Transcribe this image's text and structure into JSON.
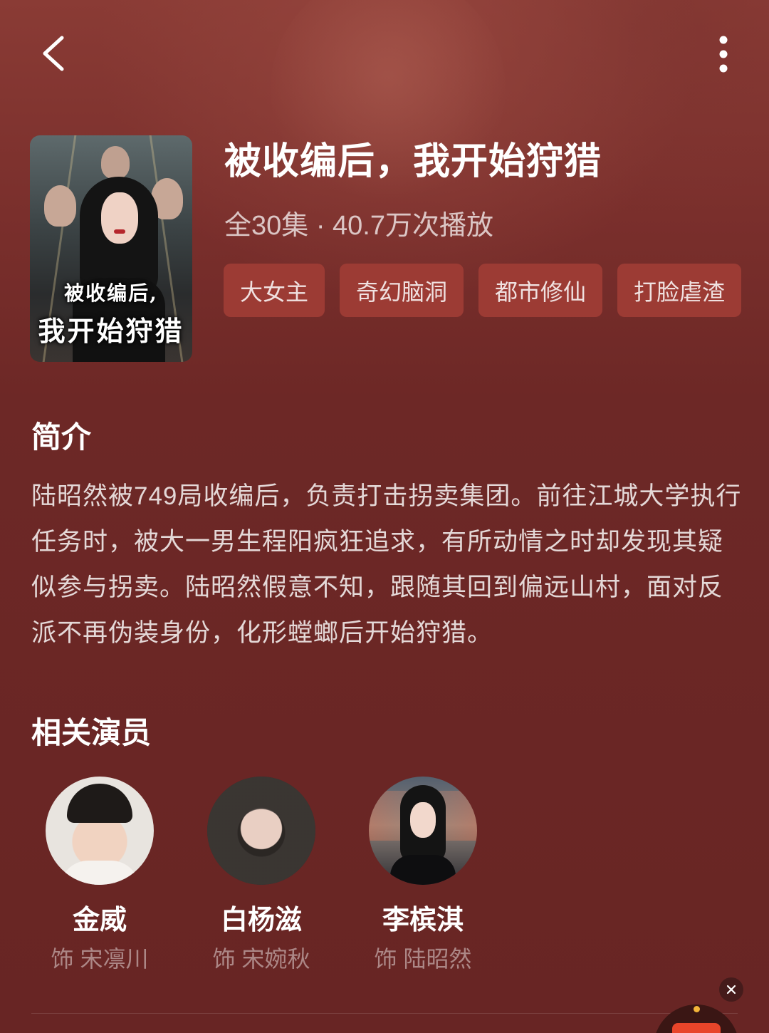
{
  "header": {
    "back_icon": "chevron-left-icon",
    "more_icon": "more-vertical-icon"
  },
  "poster": {
    "title_line1": "被收编后,",
    "title_line2": "我开始狩猎"
  },
  "drama": {
    "title": "被收编后，我开始狩猎",
    "meta": "全30集 · 40.7万次播放",
    "tags": [
      "大女主",
      "奇幻脑洞",
      "都市修仙",
      "打脸虐渣"
    ]
  },
  "intro": {
    "heading": "简介",
    "text": "陆昭然被749局收编后，负责打击拐卖集团。前往江城大学执行任务时，被大一男生程阳疯狂追求，有所动情之时却发现其疑似参与拐卖。陆昭然假意不知，跟随其回到偏远山村，面对反派不再伪装身份，化形螳螂后开始狩猎。"
  },
  "cast": {
    "heading": "相关演员",
    "actors": [
      {
        "name": "金威",
        "role": "饰 宋凛川"
      },
      {
        "name": "白杨滋",
        "role": "饰 宋婉秋"
      },
      {
        "name": "李槟淇",
        "role": "饰 陆昭然"
      }
    ]
  },
  "floating": {
    "close_icon": "close-icon",
    "close_label": "×"
  },
  "colors": {
    "background": "#6a2523",
    "tag_background": "#9c3b34",
    "accent": "#e8452a"
  }
}
